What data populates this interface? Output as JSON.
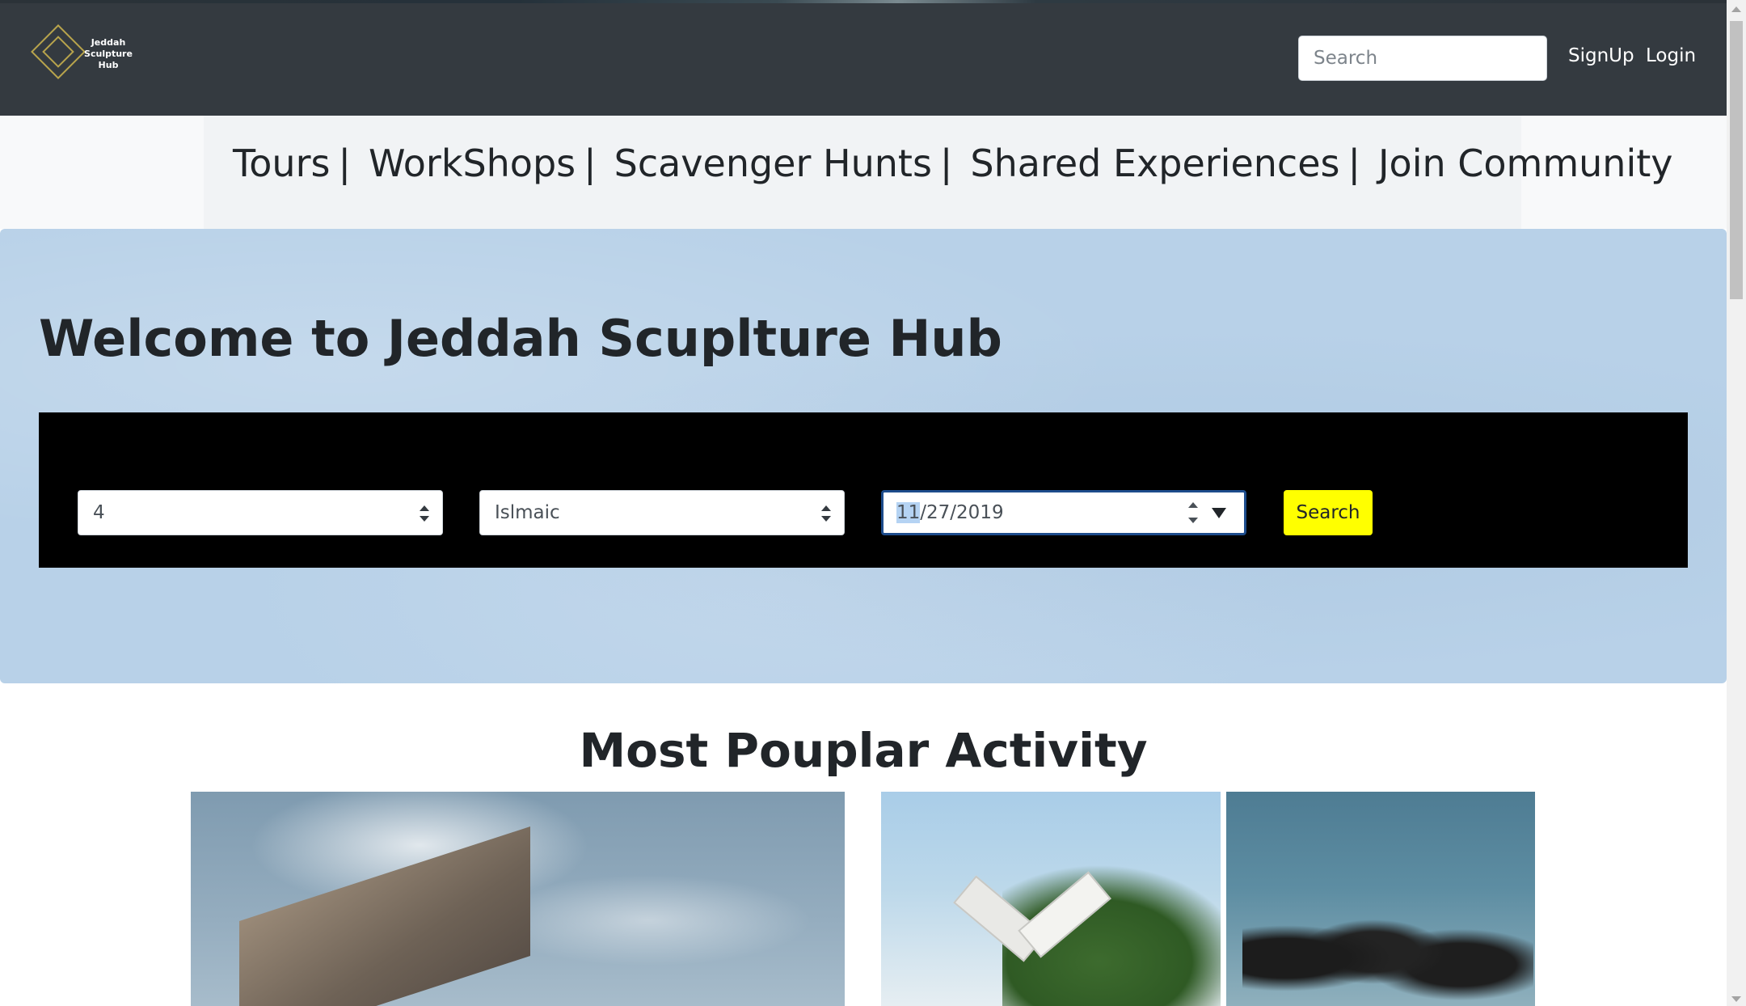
{
  "header": {
    "logo_text": "Jeddah Sculpture Hub",
    "search": {
      "placeholder": "Search",
      "value": ""
    },
    "signup_label": "SignUp",
    "login_label": "Login"
  },
  "nav": {
    "items": [
      "Tours",
      "WorkShops",
      "Scavenger Hunts",
      "Shared Experiences",
      "Join Community"
    ],
    "separator": "|"
  },
  "hero": {
    "title": "Welcome to Jeddah Scuplture Hub",
    "form": {
      "count_select": {
        "value": "4"
      },
      "category_select": {
        "value": "Islmaic"
      },
      "date_input": {
        "value_highlighted": "11",
        "value_rest": "/27/2019"
      },
      "search_button_label": "Search"
    }
  },
  "popular": {
    "title": "Most Pouplar Activity",
    "images": [
      "sculpture-slab-photo",
      "open-book-sculpture-photo",
      "calligraphy-sculpture-photo"
    ]
  },
  "colors": {
    "header_bg": "#343a40",
    "hero_bg": "#b8d1e8",
    "search_button": "#ffff00",
    "logo_gold": "#b8a44c"
  },
  "icons": [
    "logo-icon",
    "select-arrows-icon",
    "spin-icon",
    "dropdown-icon"
  ]
}
